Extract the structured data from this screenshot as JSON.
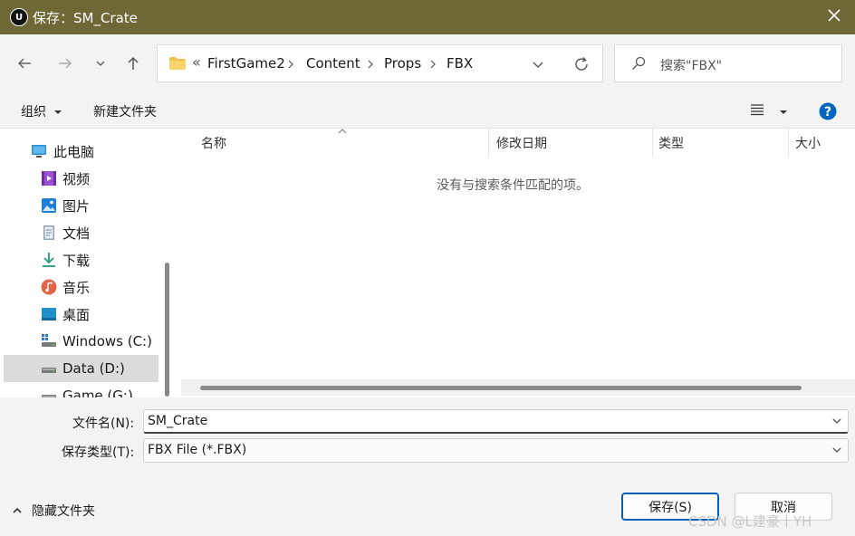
{
  "window": {
    "logo_text": "U",
    "title": "保存：SM_Crate"
  },
  "address": {
    "overflow": "«",
    "crumbs": [
      "FirstGame2",
      "Content",
      "Props",
      "FBX"
    ]
  },
  "search": {
    "placeholder": "搜索\"FBX\""
  },
  "toolbar": {
    "organize": "组织",
    "new_folder": "新建文件夹"
  },
  "sidebar": {
    "items": [
      {
        "label": "此电脑",
        "icon": "computer-icon"
      },
      {
        "label": "视频",
        "icon": "video-icon"
      },
      {
        "label": "图片",
        "icon": "pictures-icon"
      },
      {
        "label": "文档",
        "icon": "documents-icon"
      },
      {
        "label": "下载",
        "icon": "download-icon"
      },
      {
        "label": "音乐",
        "icon": "music-icon"
      },
      {
        "label": "桌面",
        "icon": "desktop-icon"
      },
      {
        "label": "Windows (C:)",
        "icon": "windows-drive-icon"
      },
      {
        "label": "Data (D:)",
        "icon": "drive-icon",
        "selected": true
      },
      {
        "label": "Game (G:)",
        "icon": "drive-icon"
      }
    ]
  },
  "columns": [
    "名称",
    "修改日期",
    "类型",
    "大小"
  ],
  "empty_message": "没有与搜索条件匹配的项。",
  "form": {
    "filename_label": "文件名(N):",
    "filename_value": "SM_Crate",
    "filetype_label": "保存类型(T):",
    "filetype_value": "FBX File (*.FBX)"
  },
  "footer": {
    "hide_folders": "隐藏文件夹",
    "save": "保存(S)",
    "cancel": "取消",
    "watermark": "CSDN @L建豪丨YH"
  },
  "colors": {
    "titlebar": "#6e6836",
    "accent": "#005fb8",
    "help": "#0067c0"
  }
}
